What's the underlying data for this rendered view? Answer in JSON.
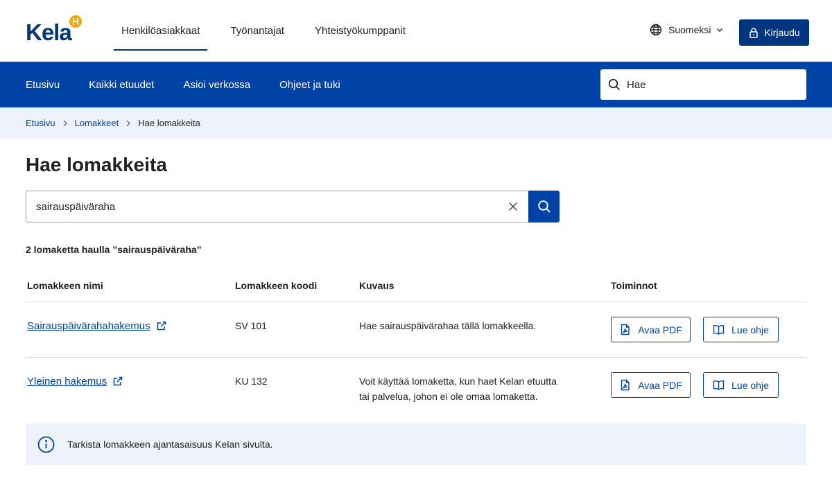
{
  "header": {
    "logo_text": "Kela",
    "nav": [
      {
        "label": "Henkilöasiakkaat",
        "active": true
      },
      {
        "label": "Työnantajat",
        "active": false
      },
      {
        "label": "Yhteistyökumppanit",
        "active": false
      }
    ],
    "language": "Suomeksi",
    "login_label": "Kirjaudu"
  },
  "subnav": {
    "items": [
      "Etusivu",
      "Kaikki etuudet",
      "Asioi verkossa",
      "Ohjeet ja tuki"
    ],
    "search_placeholder": "Hae"
  },
  "breadcrumb": {
    "items": [
      "Etusivu",
      "Lomakkeet"
    ],
    "current": "Hae lomakkeita"
  },
  "main": {
    "title": "Hae lomakkeita",
    "search_value": "sairauspäiväraha",
    "result_count": "2 lomaketta haulla ”sairauspäiväraha”",
    "table": {
      "headers": [
        "Lomakkeen nimi",
        "Lomakkeen koodi",
        "Kuvaus",
        "Toiminnot"
      ],
      "rows": [
        {
          "name": "Sairauspäivärahahakemus",
          "code": "SV 101",
          "desc_line1": "Hae sairauspäivärahaa tällä lomakkeella.",
          "desc_line2": "",
          "pdf_label": "Avaa PDF",
          "guide_label": "Lue ohje"
        },
        {
          "name": "Yleinen hakemus",
          "code": "KU 132",
          "desc_line1": "Voit käyttää lomaketta, kun haet Kelan etuutta",
          "desc_line2": "tai palvelua, johon ei ole omaa lomaketta.",
          "pdf_label": "Avaa PDF",
          "guide_label": "Lue ohje"
        }
      ]
    },
    "notice": "Tarkista lomakkeen ajantasaisuus Kelan sivulta."
  },
  "colors": {
    "brand_dark": "#003580",
    "brand_blue": "#0043a7",
    "light_bg": "#eef3fb",
    "logo_accent": "#f5a800"
  },
  "icons": [
    "globe-icon",
    "chevron-down-icon",
    "lock-icon",
    "search-icon",
    "chevron-right-icon",
    "close-icon",
    "external-link-icon",
    "pdf-file-icon",
    "book-icon",
    "info-icon"
  ]
}
